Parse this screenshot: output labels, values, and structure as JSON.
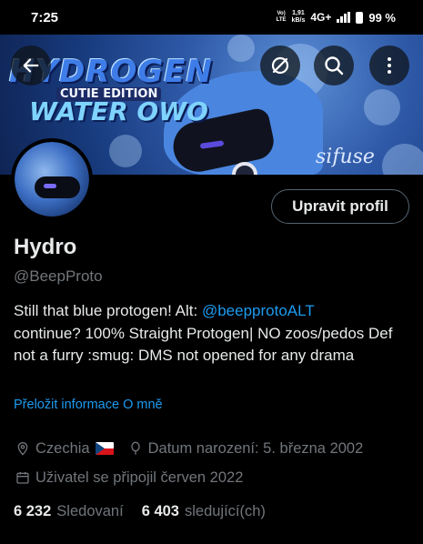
{
  "status_bar": {
    "time": "7:25",
    "volte_top": "Vo)",
    "volte_bottom": "LTE",
    "speed_value": "1,91",
    "speed_unit": "kB/s",
    "network": "4G+",
    "battery_percent": "99 %",
    "battery_level": 0.99,
    "signal_bars": 4
  },
  "banner": {
    "logo_title": "HYDROGEN",
    "logo_subtitle": "CUTIE EDITION",
    "logo_bottom": "WATER OWO",
    "signature": "sifuse"
  },
  "header_buttons": {
    "back": {
      "icon": "arrow-left-icon"
    },
    "hide": {
      "icon": "eye-slash-icon"
    },
    "search": {
      "icon": "search-icon"
    },
    "more": {
      "icon": "more-vertical-icon"
    }
  },
  "profile": {
    "edit_button_label": "Upravit profil",
    "display_name": "Hydro",
    "handle": "@BeepProto",
    "bio_line1_text": "Still that blue protogen! Alt: ",
    "bio_line1_mention": "@beepprotoALT",
    "bio_rest": "continue? 100% Straight Protogen| NO zoos/pedos Def not a furry :smug: DMS not opened for any drama",
    "translate_link": "Přeložit informace O mně",
    "location": "Czechia",
    "location_flag": "🇨🇿",
    "birthday": "Datum narození: 5. března 2002",
    "joined": "Uživatel se připojil červen 2022",
    "following_count": "6 232",
    "following_label": "Sledovaní",
    "followers_count": "6 403",
    "followers_label": "sledující(ch)"
  },
  "colors": {
    "background": "#000000",
    "text_primary": "#e7e9ea",
    "text_secondary": "#71767b",
    "accent": "#1d9bf0",
    "button_border": "#536471"
  }
}
